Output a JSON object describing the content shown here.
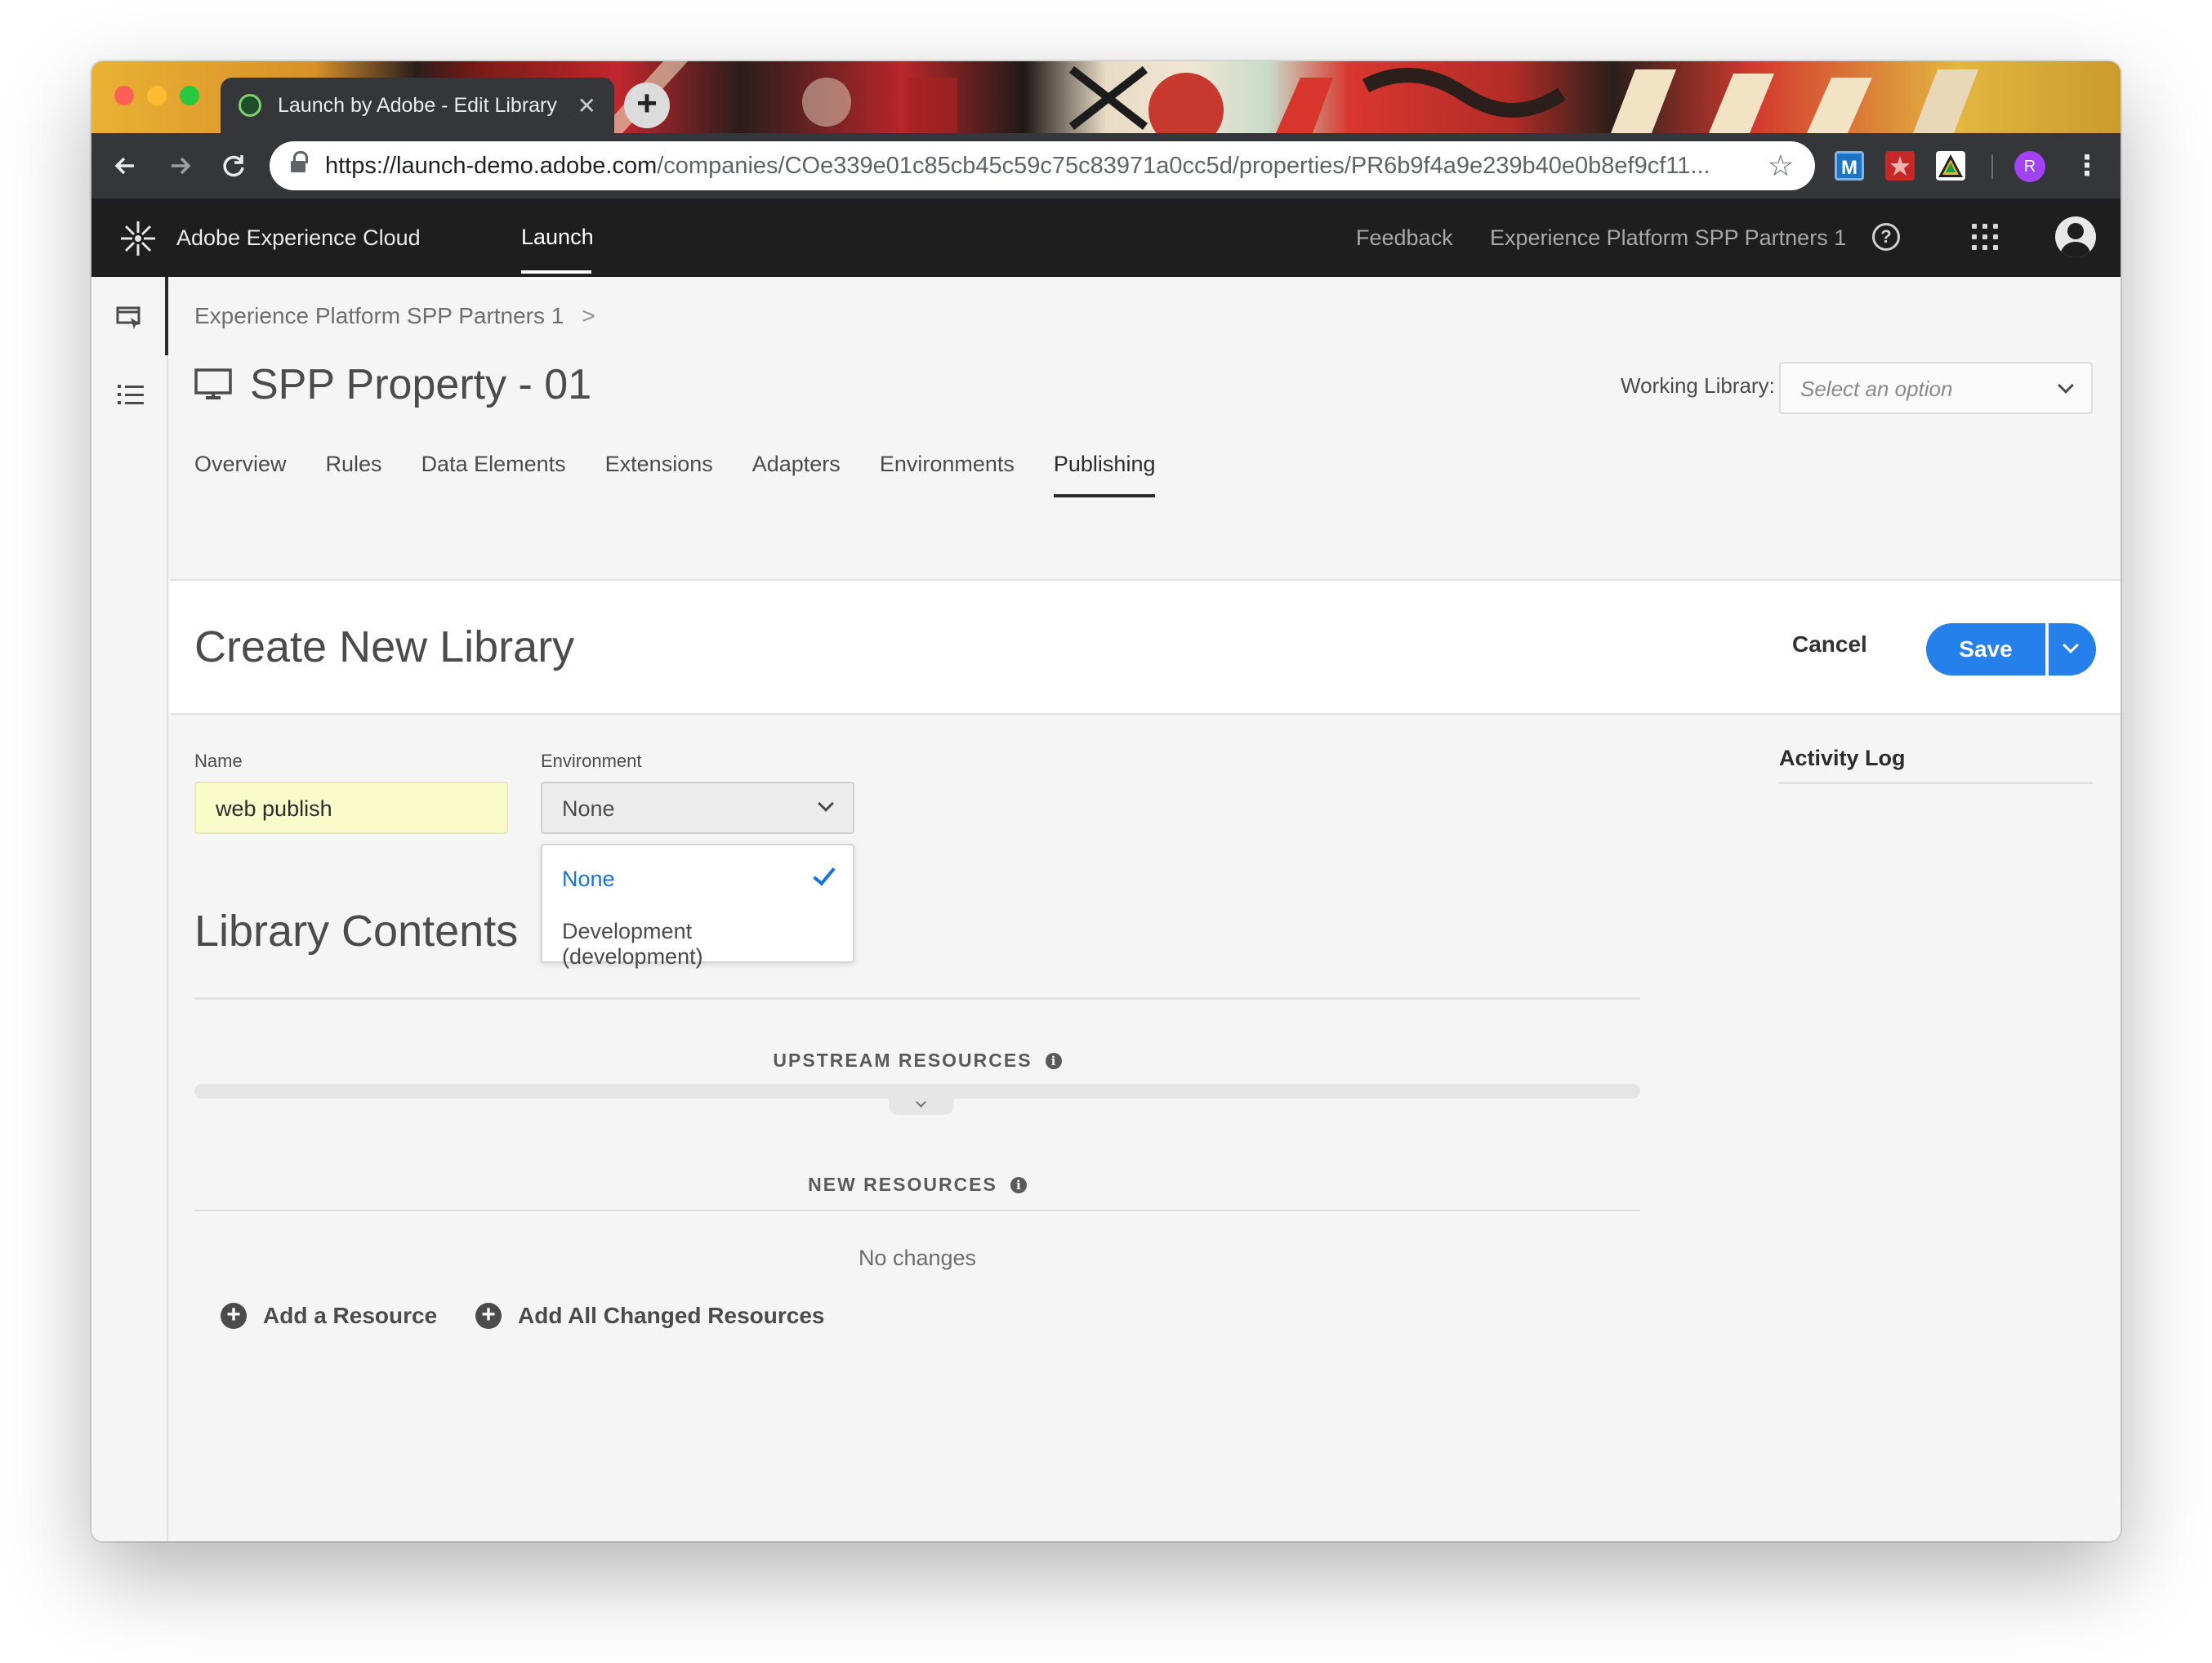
{
  "browser": {
    "tab_title": "Launch by Adobe - Edit Library",
    "new_tab": "+",
    "url_domain": "https://launch-demo.adobe.com",
    "url_path": "/companies/COe339e01c85cb45c59c75c83971a0cc5d/properties/PR6b9f4a9e239b40e0b8ef9cf11...",
    "profile_initial": "R",
    "extensions": [
      {
        "name": "m-extension-icon",
        "label": "M",
        "color": "#1d74c6"
      },
      {
        "name": "red-extension-icon",
        "label": "",
        "color": "#c62828"
      },
      {
        "name": "triangle-extension-icon",
        "label": "",
        "color": "#ffffff"
      }
    ]
  },
  "app_header": {
    "brand": "Adobe Experience Cloud",
    "launch": "Launch",
    "feedback": "Feedback",
    "org": "Experience Platform SPP Partners 1"
  },
  "breadcrumb": {
    "parent": "Experience Platform SPP Partners 1",
    "separator": ">"
  },
  "property": {
    "title": "SPP Property - 01"
  },
  "working_library": {
    "label": "Working Library:",
    "placeholder": "Select an option"
  },
  "tabs": [
    "Overview",
    "Rules",
    "Data Elements",
    "Extensions",
    "Adapters",
    "Environments",
    "Publishing"
  ],
  "active_tab": "Publishing",
  "panel": {
    "title": "Create New Library",
    "cancel": "Cancel",
    "save": "Save"
  },
  "form": {
    "name_label": "Name",
    "name_value": "web publish",
    "environment_label": "Environment",
    "environment_value": "None",
    "environment_options": [
      "None",
      "Development (development)"
    ]
  },
  "library_contents": {
    "title": "Library Contents",
    "upstream_title": "UPSTREAM RESOURCES",
    "new_title": "NEW RESOURCES",
    "info_glyph": "i",
    "no_changes": "No changes",
    "add_resource": "Add a Resource",
    "add_all": "Add All Changed Resources"
  },
  "activity_log": {
    "title": "Activity Log"
  },
  "colors": {
    "accent": "#2680eb",
    "selected_option": "#1473e6",
    "name_field_bg": "#fafbcb",
    "header_bg": "#1e1e1e"
  }
}
